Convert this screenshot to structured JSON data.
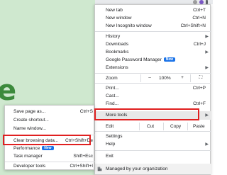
{
  "main_menu": {
    "new_tab": {
      "label": "New tab",
      "shortcut": "Ctrl+T"
    },
    "new_window": {
      "label": "New window",
      "shortcut": "Ctrl+N"
    },
    "new_incognito": {
      "label": "New Incognito window",
      "shortcut": "Ctrl+Shift+N"
    },
    "history": {
      "label": "History"
    },
    "downloads": {
      "label": "Downloads",
      "shortcut": "Ctrl+J"
    },
    "bookmarks": {
      "label": "Bookmarks"
    },
    "password_manager": {
      "label": "Google Password Manager",
      "badge": "New"
    },
    "extensions": {
      "label": "Extensions"
    },
    "zoom": {
      "label": "Zoom",
      "minus": "–",
      "value": "100%",
      "plus": "+",
      "fullscreen": "⛶"
    },
    "print": {
      "label": "Print...",
      "shortcut": "Ctrl+P"
    },
    "cast": {
      "label": "Cast..."
    },
    "find": {
      "label": "Find...",
      "shortcut": "Ctrl+F"
    },
    "more_tools": {
      "label": "More tools"
    },
    "edit": {
      "label": "Edit",
      "cut": "Cut",
      "copy": "Copy",
      "paste": "Paste"
    },
    "settings": {
      "label": "Settings"
    },
    "help": {
      "label": "Help"
    },
    "exit": {
      "label": "Exit"
    },
    "managed": {
      "label": "Managed by your organization"
    }
  },
  "sub_menu": {
    "save_page": {
      "label": "Save page as...",
      "shortcut": "Ctrl+S"
    },
    "create_shortcut": {
      "label": "Create shortcut..."
    },
    "name_window": {
      "label": "Name window..."
    },
    "clear_browsing": {
      "label": "Clear browsing data...",
      "shortcut": "Ctrl+Shift+De"
    },
    "performance": {
      "label": "Performance",
      "badge": "New"
    },
    "task_manager": {
      "label": "Task manager",
      "shortcut": "Shift+Esc"
    },
    "developer_tools": {
      "label": "Developer tools",
      "shortcut": "Ctrl+Shift+I"
    }
  },
  "background": {
    "big_letter": "e"
  },
  "colors": {
    "highlight": "#e02020",
    "badge": "#1a73e8",
    "page_green": "#cfe8cf"
  }
}
